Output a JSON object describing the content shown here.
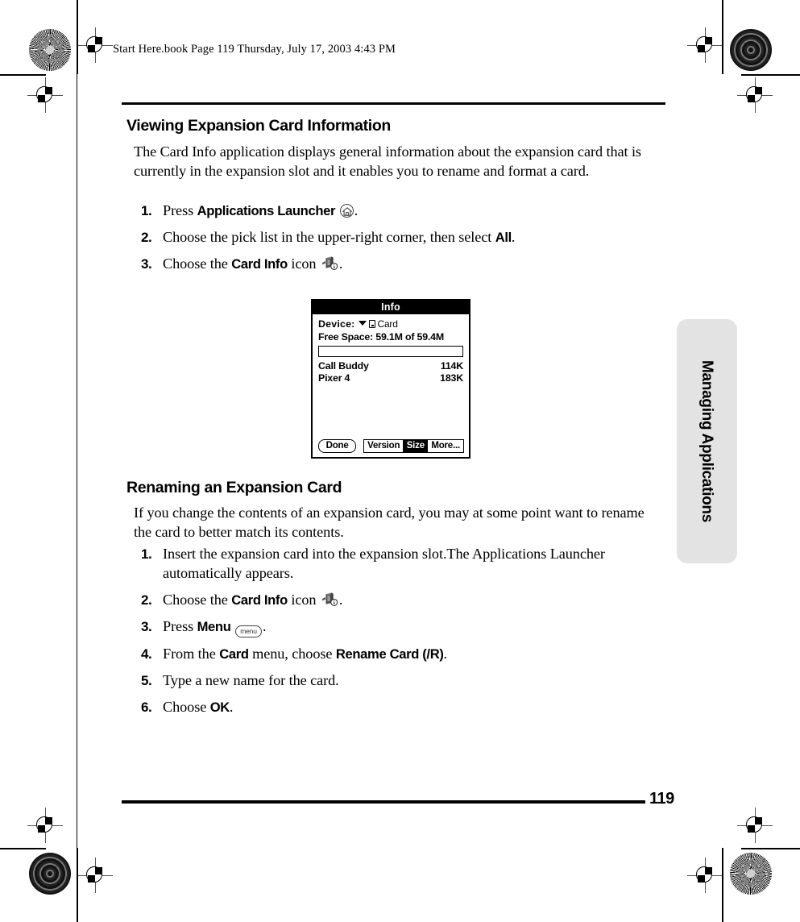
{
  "page": {
    "running_header": "Start Here.book  Page 119  Thursday, July 17, 2003  4:43 PM",
    "folio": "119",
    "thumb_tab": "Managing Applications"
  },
  "sections": [
    {
      "heading": "Viewing Expansion Card Information",
      "intro": "The Card Info application displays general information about the expansion card that is currently in the expansion slot and it enables you to rename and format a card.",
      "steps": [
        {
          "num": "1.",
          "pre": "Press ",
          "ui": "Applications Launcher",
          "icon": "home-button-icon",
          "post": "."
        },
        {
          "num": "2.",
          "pre": "Choose the pick list in the upper-right corner, then select ",
          "ui": "All",
          "icon": "",
          "post": "."
        },
        {
          "num": "3.",
          "pre": "Choose the ",
          "ui": "Card Info",
          "mid": " icon ",
          "icon": "card-info-icon",
          "post": "."
        }
      ]
    },
    {
      "heading": "Renaming an Expansion Card",
      "intro": "If you change the contents of an expansion card, you may at some point want to rename the card to better match its contents.",
      "steps": [
        {
          "num": "1.",
          "pre": "Insert the expansion card into the expansion slot.The Applications Launcher automatically appears.",
          "ui": "",
          "icon": "",
          "post": ""
        },
        {
          "num": "2.",
          "pre": "Choose the ",
          "ui": "Card Info",
          "mid": " icon ",
          "icon": "card-info-icon",
          "post": "."
        },
        {
          "num": "3.",
          "pre": "Press ",
          "ui": "Menu",
          "icon": "menu-button-icon",
          "post": "."
        },
        {
          "num": "4.",
          "pre": "From the ",
          "ui": "Card",
          "mid": " menu, choose ",
          "ui2": "Rename Card (/R)",
          "icon": "",
          "post": "."
        },
        {
          "num": "5.",
          "pre": "Type a new name for the card.",
          "ui": "",
          "icon": "",
          "post": ""
        },
        {
          "num": "6.",
          "pre": "Choose ",
          "ui": "OK",
          "icon": "",
          "post": "."
        }
      ]
    }
  ],
  "pda_screenshot": {
    "title": "Info",
    "device_label": "Device:",
    "device_value": "Card",
    "free_space_label": "Free Space:",
    "free_space_value": "59.1M of 59.4M",
    "free_space_line": "Free Space: 59.1M of 59.4M",
    "apps": [
      {
        "name": "Call Buddy",
        "size": "114K"
      },
      {
        "name": "Pixer 4",
        "size": "183K"
      }
    ],
    "buttons": {
      "done": "Done",
      "version": "Version",
      "size": "Size",
      "more": "More...",
      "selected": "Size"
    }
  },
  "icons": {
    "menu_label": "menu"
  }
}
